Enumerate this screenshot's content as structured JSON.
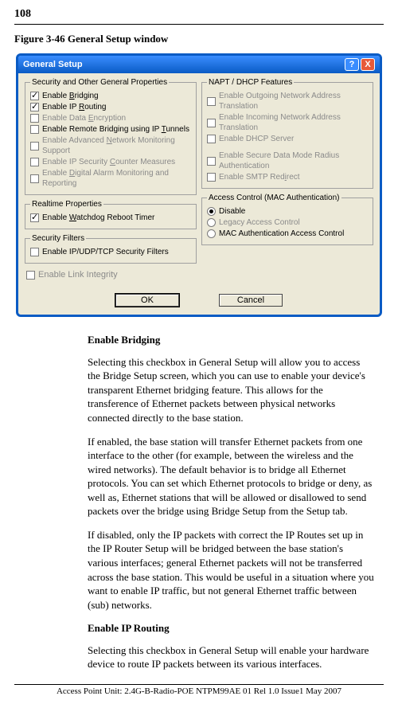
{
  "page_number": "108",
  "caption": "Figure 3-46  General Setup window",
  "window": {
    "title": "General Setup",
    "help_label": "?",
    "close_label": "X",
    "groups": {
      "security": {
        "legend": "Security and Other General Properties",
        "bridging": "Enable Bridging",
        "ip_routing": "Enable IP Routing",
        "data_encryption": "Enable Data Encryption",
        "remote_bridging": "Enable Remote Bridging using IP Tunnels",
        "network_monitoring": "Enable Advanced Network Monitoring Support",
        "counter_measures": "Enable IP Security Counter Measures",
        "digital_alarm": "Enable Digital Alarm Monitoring and Reporting"
      },
      "realtime": {
        "legend": "Realtime Properties",
        "watchdog": "Enable Watchdog Reboot Timer"
      },
      "filters": {
        "legend": "Security Filters",
        "ip_filters": "Enable IP/UDP/TCP Security Filters"
      },
      "link_integrity": "Enable Link Integrity",
      "napt": {
        "legend": "NAPT / DHCP Features",
        "outgoing_nat": "Enable Outgoing Network Address Translation",
        "incoming_nat": "Enable Incoming Network Address Translation",
        "dhcp_server": "Enable DHCP Server",
        "radius_auth": "Enable Secure Data Mode Radius Authentication",
        "smtp_redirect": "Enable SMTP Redirect"
      },
      "access_control": {
        "legend": "Access Control (MAC Authentication)",
        "disable": "Disable",
        "legacy": "Legacy Access Control",
        "mac_auth": "MAC Authentication Access Control"
      }
    },
    "ok_label": "OK",
    "cancel_label": "Cancel"
  },
  "text": {
    "h1": "Enable Bridging",
    "p1": "Selecting this checkbox in General Setup will allow you to access the Bridge Setup screen, which you can use to enable your device's transparent Ethernet bridging feature.  This allows for the transference of Ethernet packets between physical networks connected directly to the base station.",
    "p2": "If enabled, the base station will transfer Ethernet packets from one interface to the other (for example, between the wireless and the wired networks). The default behavior is to bridge all Ethernet protocols. You can set which Ethernet protocols to bridge or deny, as well as, Ethernet stations that will be allowed or disallowed to send packets over the bridge using Bridge Setup from the Setup tab.",
    "p3": "If disabled, only the IP packets with correct the IP Routes set up in the IP Router Setup will be bridged between the base station's various interfaces; general Ethernet packets will not be transferred across the base station. This would be useful in a situation where you want to enable IP traffic, but not general Ethernet traffic between (sub) networks.",
    "h2": "Enable IP Routing",
    "p4": "Selecting this checkbox in General Setup will enable your hardware device to route IP packets between its various interfaces."
  },
  "footer": "Access Point Unit: 2.4G-B-Radio-POE     NTPM99AE 01  Rel 1.0 Issue1 May 2007"
}
